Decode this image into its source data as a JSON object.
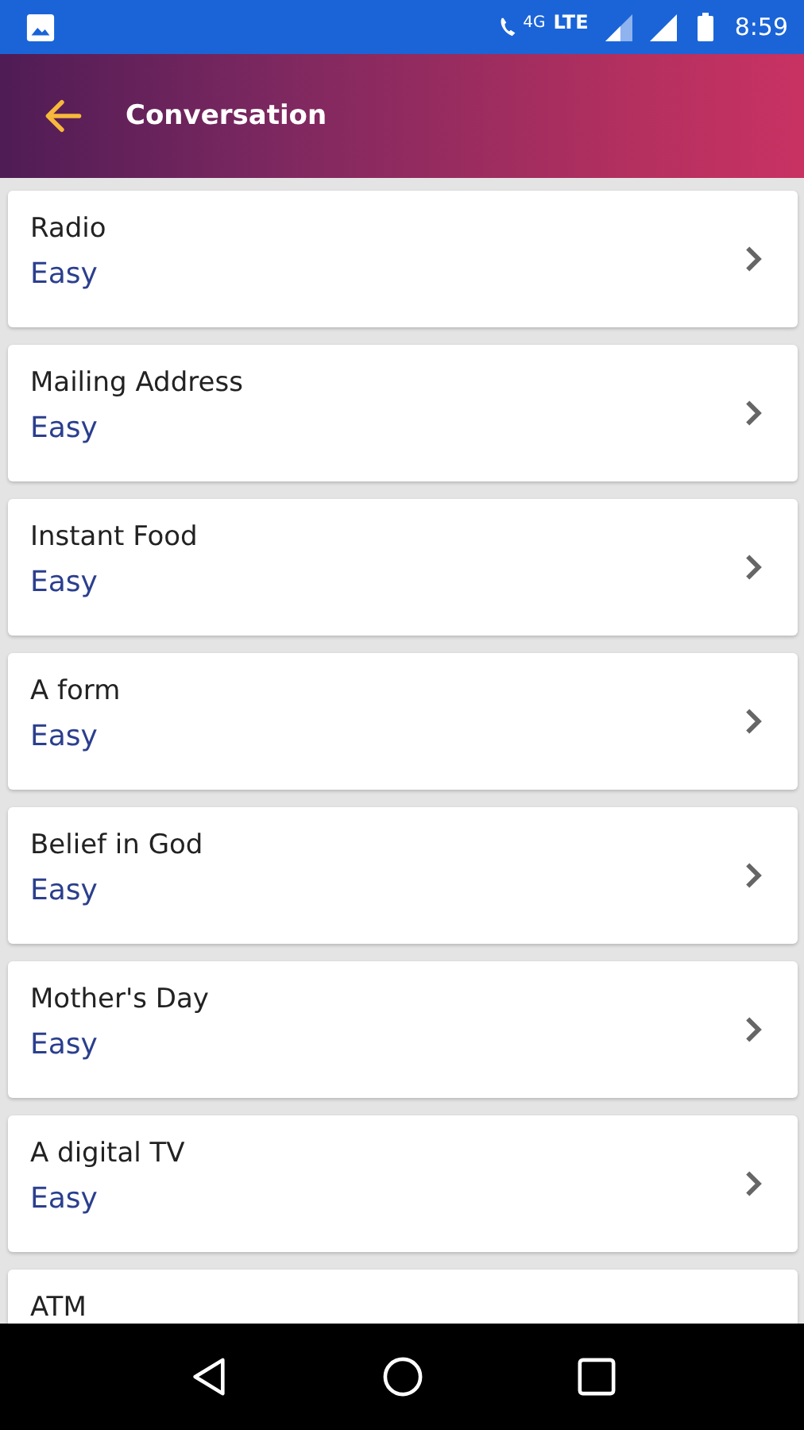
{
  "status_bar": {
    "network": "4G",
    "network_type": "LTE",
    "time": "8:59"
  },
  "app_bar": {
    "title": "Conversation"
  },
  "items": [
    {
      "title": "Radio",
      "level_label": "Easy"
    },
    {
      "title": "Mailing Address",
      "level_label": "Easy"
    },
    {
      "title": "Instant Food",
      "level_label": "Easy"
    },
    {
      "title": "A form",
      "level_label": "Easy"
    },
    {
      "title": "Belief in God",
      "level_label": "Easy"
    },
    {
      "title": "Mother's Day",
      "level_label": "Easy"
    },
    {
      "title": "A digital TV",
      "level_label": "Easy"
    },
    {
      "title": "ATM"
    }
  ]
}
